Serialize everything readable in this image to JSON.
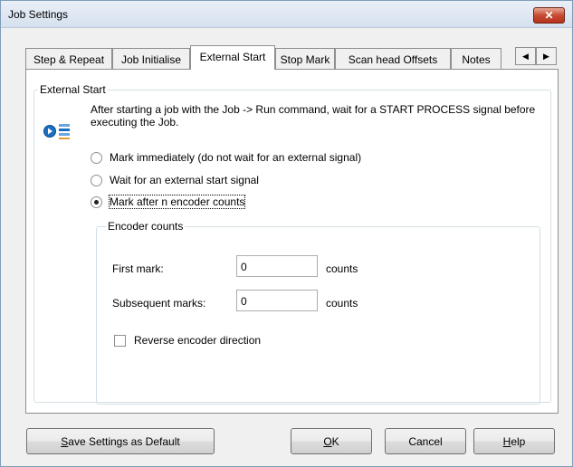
{
  "window": {
    "title": "Job Settings",
    "close_glyph": "✕"
  },
  "tabs": [
    {
      "label": "Step & Repeat",
      "active": false
    },
    {
      "label": "Job Initialise",
      "active": false
    },
    {
      "label": "External Start",
      "active": true
    },
    {
      "label": "Stop Mark",
      "active": false
    },
    {
      "label": "Scan head Offsets",
      "active": false
    },
    {
      "label": "Notes",
      "active": false
    }
  ],
  "tab_scroll": {
    "left": "◀",
    "right": "▶"
  },
  "external_start": {
    "group_label": "External Start",
    "description": "After starting a job with the Job -> Run command, wait for a START PROCESS signal before executing the Job.",
    "icon": "signal-start-icon",
    "options": [
      {
        "label": "Mark immediately (do not wait for an external signal)",
        "checked": false
      },
      {
        "label": "Wait for an external start signal",
        "checked": false
      },
      {
        "label": "Mark after n encoder counts",
        "checked": true
      }
    ]
  },
  "encoder": {
    "group_label": "Encoder counts",
    "first_mark_label": "First mark:",
    "first_mark_value": "0",
    "subsequent_label": "Subsequent marks:",
    "subsequent_value": "0",
    "unit": "counts",
    "reverse_label": "Reverse encoder direction",
    "reverse_checked": false
  },
  "buttons": {
    "save_default_u": "S",
    "save_default_rest": "ave Settings as Default",
    "ok_u": "O",
    "ok_rest": "K",
    "cancel": "Cancel",
    "help_u": "H",
    "help_rest": "elp"
  },
  "colors": {
    "accent": "#1a6fc4",
    "close": "#c74a32"
  }
}
